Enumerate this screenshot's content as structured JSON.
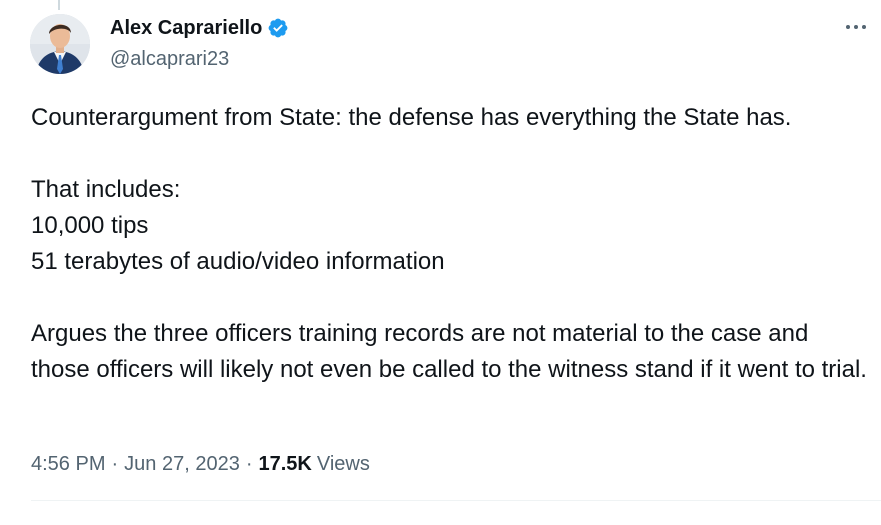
{
  "author": {
    "display_name": "Alex Caprariello",
    "handle": "@alcaprari23",
    "verified_icon": "verified-badge-icon"
  },
  "tweet": {
    "lines": [
      "Counterargument from State: the defense has everything the State has.",
      "",
      "That includes:",
      "10,000 tips",
      "51 terabytes of audio/video information",
      "",
      "Argues the three officers training records are not material to the case and those officers will likely not even be called to the witness stand if it went to trial."
    ]
  },
  "meta": {
    "time": "4:56 PM",
    "separator": "·",
    "date": "Jun 27, 2023",
    "views_count": "17.5K",
    "views_label": "Views"
  },
  "colors": {
    "text": "#0f1419",
    "secondary": "#536471",
    "verified": "#1d9bf0"
  }
}
